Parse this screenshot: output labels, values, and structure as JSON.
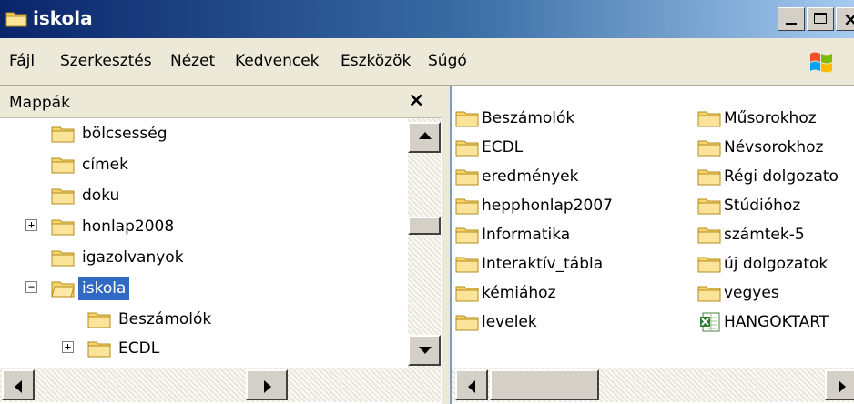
{
  "window": {
    "title": "iskola"
  },
  "menu": [
    "Fájl",
    "Szerkesztés",
    "Nézet",
    "Kedvencek",
    "Eszközök",
    "Súgó"
  ],
  "folders_panel": {
    "title": "Mappák",
    "close_glyph": "×",
    "tree": [
      {
        "label": "bölcsesség",
        "expander": "",
        "selected": false
      },
      {
        "label": "címek",
        "expander": "",
        "selected": false
      },
      {
        "label": "doku",
        "expander": "",
        "selected": false
      },
      {
        "label": "honlap2008",
        "expander": "+",
        "selected": false
      },
      {
        "label": "igazolvanyok",
        "expander": "",
        "selected": false
      },
      {
        "label": "iskola",
        "expander": "−",
        "selected": true
      },
      {
        "label": "Beszámolók",
        "expander": "",
        "selected": false
      },
      {
        "label": "ECDL",
        "expander": "+",
        "selected": false
      }
    ]
  },
  "files": {
    "column1": [
      "Beszámolók",
      "ECDL",
      "eredmények",
      "hepphonlap2007",
      "Informatika",
      "Interaktív_tábla",
      "kémiához",
      "levelek"
    ],
    "column2": [
      {
        "label": "Műsorokhoz",
        "icon": "folder-icon"
      },
      {
        "label": "Névsorokhoz",
        "icon": "folder-icon"
      },
      {
        "label": "Régi dolgozato",
        "icon": "folder-icon"
      },
      {
        "label": "Stúdióhoz",
        "icon": "folder-icon"
      },
      {
        "label": "számtek-5",
        "icon": "folder-icon"
      },
      {
        "label": "új dolgozatok",
        "icon": "folder-icon"
      },
      {
        "label": "vegyes",
        "icon": "folder-icon"
      },
      {
        "label": "HANGOKTART",
        "icon": "excel-file-icon"
      }
    ]
  },
  "colors": {
    "selection": "#316ac5",
    "folder": "#f7d56a",
    "title_bar": "#0a246a"
  }
}
